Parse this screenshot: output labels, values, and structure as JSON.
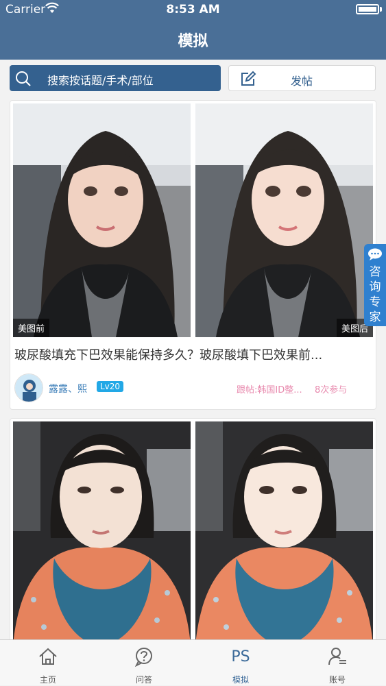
{
  "status_bar": {
    "carrier": "Carrier",
    "time": "8:53 AM"
  },
  "header": {
    "title": "模拟"
  },
  "search": {
    "placeholder": "搜索按话题/手术/部位"
  },
  "post_button": {
    "label": "发帖"
  },
  "consult": {
    "label": "咨询专家"
  },
  "posts": [
    {
      "before_tag": "美图前",
      "after_tag": "美图后",
      "title": "玻尿酸填充下巴效果能保持多久？玻尿酸填下巴效果前...",
      "user": "露露、熙",
      "level": "Lv20",
      "followup": "跟帖:韩国ID整...",
      "count": "8次参与"
    },
    {}
  ],
  "tabs": [
    {
      "label": "主页",
      "icon": "home-icon"
    },
    {
      "label": "问答",
      "icon": "qa-icon"
    },
    {
      "label": "模拟",
      "icon": "ps-icon",
      "glyph": "PS",
      "active": true
    },
    {
      "label": "账号",
      "icon": "account-icon"
    }
  ],
  "colors": {
    "header": "#4a6f97",
    "search_bg": "#34618f",
    "accent_blue": "#3e7fb9",
    "level_badge": "#22a8e6",
    "pink_text": "#e88aae",
    "consult_bg": "#2f80cf"
  }
}
